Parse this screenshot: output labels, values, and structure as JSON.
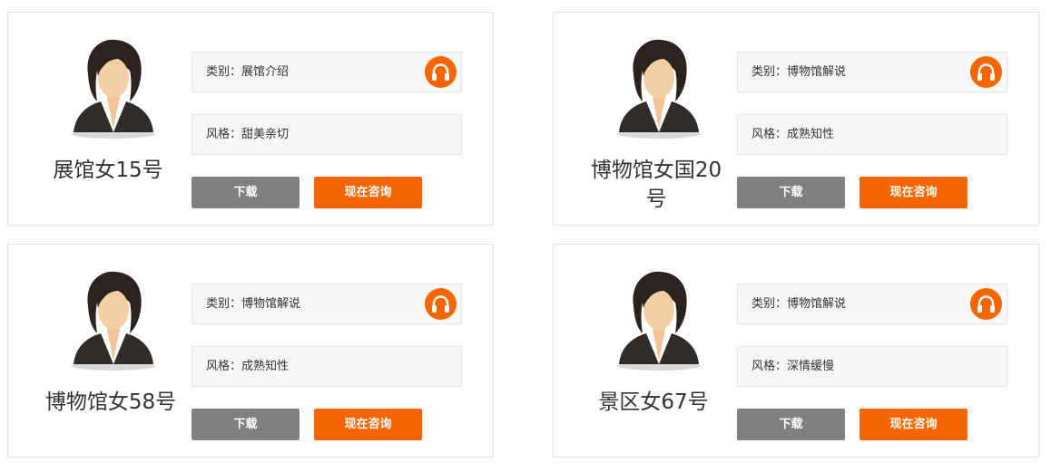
{
  "labels": {
    "type_label": "类别：",
    "style_label": "风格：",
    "download_label": "下载",
    "consult_label": "现在咨询"
  },
  "accent_color": "#f56600",
  "icons": {
    "avatar": "female-avatar-icon",
    "listen": "headphones-icon"
  },
  "cards": [
    {
      "name": "展馆女15号",
      "type": "展馆介绍",
      "style": "甜美亲切"
    },
    {
      "name": "博物馆女国20号",
      "type": "博物馆解说",
      "style": "成熟知性"
    },
    {
      "name": "博物馆女58号",
      "type": "博物馆解说",
      "style": "成熟知性"
    },
    {
      "name": "景区女67号",
      "type": "博物馆解说",
      "style": "深情缓慢"
    }
  ]
}
